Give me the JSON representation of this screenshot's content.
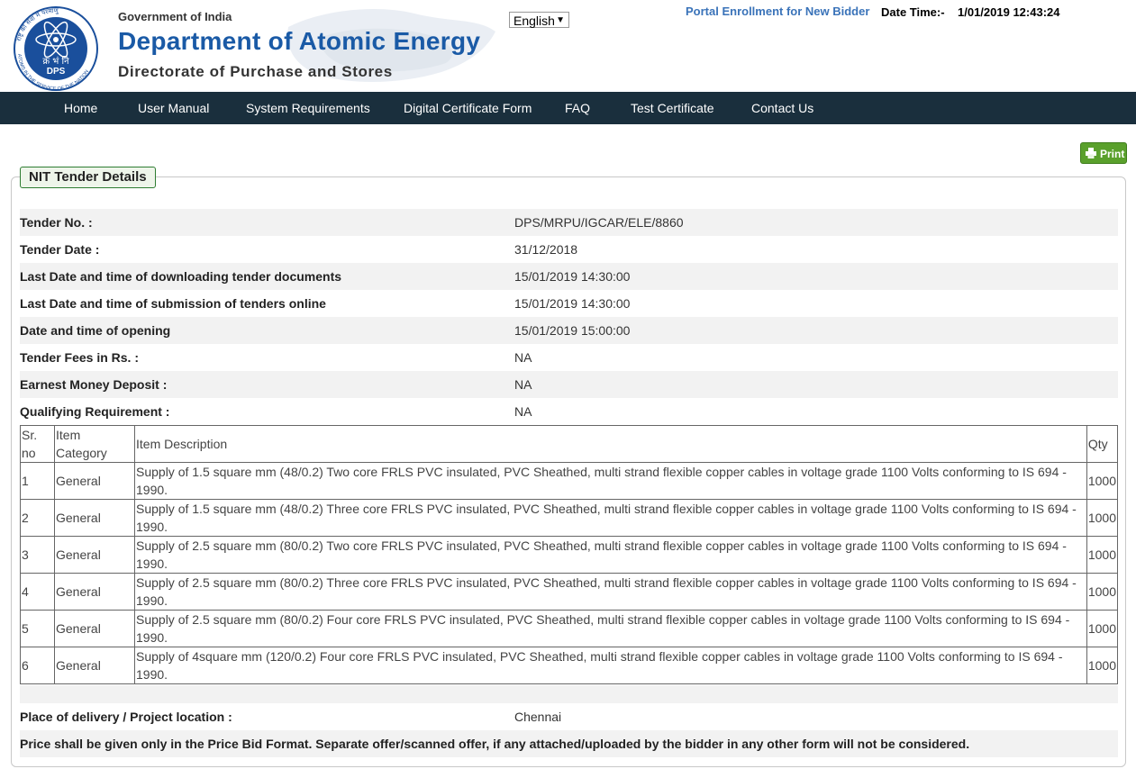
{
  "header": {
    "gov_text": "Government of India",
    "dept_text": "Department of Atomic Energy",
    "directorate_text": "Directorate of Purchase and Stores",
    "logo": {
      "top_text": "राष्ट्र की सेवा में परमाणु",
      "center_text": "क्र भं नि",
      "abbr": "DPS",
      "bottom_text": "ATOMS IN THE SERVICE OF THE NATION"
    },
    "language": "English",
    "enroll_link": "Portal Enrollment for New Bidder",
    "datetime_label": "Date Time:-",
    "datetime_value": "1/01/2019 12:43:24"
  },
  "nav": [
    "Home",
    "User Manual",
    "System Requirements",
    "Digital Certificate Form",
    "FAQ",
    "Test Certificate",
    "Contact Us"
  ],
  "print_label": "Print",
  "section_title": "NIT Tender Details",
  "details": [
    {
      "label": "Tender No. :",
      "value": "DPS/MRPU/IGCAR/ELE/8860"
    },
    {
      "label": "Tender Date :",
      "value": "31/12/2018"
    },
    {
      "label": "Last Date and time of downloading tender documents",
      "value": "15/01/2019 14:30:00"
    },
    {
      "label": "Last Date and time of submission of tenders online",
      "value": "15/01/2019 14:30:00"
    },
    {
      "label": "Date and time of opening",
      "value": "15/01/2019 15:00:00"
    },
    {
      "label": "Tender Fees in Rs. :",
      "value": "NA"
    },
    {
      "label": "Earnest Money Deposit :",
      "value": "NA"
    },
    {
      "label": "Qualifying Requirement :",
      "value": "NA"
    }
  ],
  "items_table": {
    "headers": [
      "Sr. no",
      "Item Category",
      "Item Description",
      "Qty"
    ],
    "rows": [
      [
        "1",
        "General",
        "Supply of 1.5 square mm (48/0.2) Two core FRLS PVC insulated, PVC Sheathed, multi strand flexible copper cables in voltage grade 1100 Volts conforming to IS 694 - 1990.",
        "1000"
      ],
      [
        "2",
        "General",
        "Supply of 1.5 square mm (48/0.2) Three core FRLS PVC insulated, PVC Sheathed, multi strand flexible copper cables in voltage grade 1100 Volts conforming to IS 694 - 1990.",
        "1000"
      ],
      [
        "3",
        "General",
        "Supply of 2.5 square mm (80/0.2) Two core FRLS PVC insulated, PVC Sheathed, multi strand flexible copper cables in voltage grade 1100 Volts conforming to IS 694 - 1990.",
        "1000"
      ],
      [
        "4",
        "General",
        "Supply of 2.5 square mm (80/0.2) Three core FRLS PVC insulated, PVC Sheathed, multi strand flexible copper cables in voltage grade 1100 Volts conforming to IS 694 - 1990.",
        "1000"
      ],
      [
        "5",
        "General",
        "Supply of 2.5 square mm (80/0.2) Four core FRLS PVC insulated, PVC Sheathed, multi strand flexible copper cables in voltage grade 1100 Volts conforming to IS 694 - 1990.",
        "1000"
      ],
      [
        "6",
        "General",
        "Supply of 4square mm (120/0.2) Four core FRLS PVC insulated, PVC Sheathed, multi strand flexible copper cables in voltage grade 1100 Volts conforming to IS 694 - 1990.",
        "1000"
      ]
    ]
  },
  "delivery": {
    "label": "Place of delivery / Project location :",
    "value": "Chennai"
  },
  "note": "Price shall be given only in the Price Bid Format. Separate offer/scanned offer, if any attached/uploaded by the bidder in any other form will not be considered."
}
